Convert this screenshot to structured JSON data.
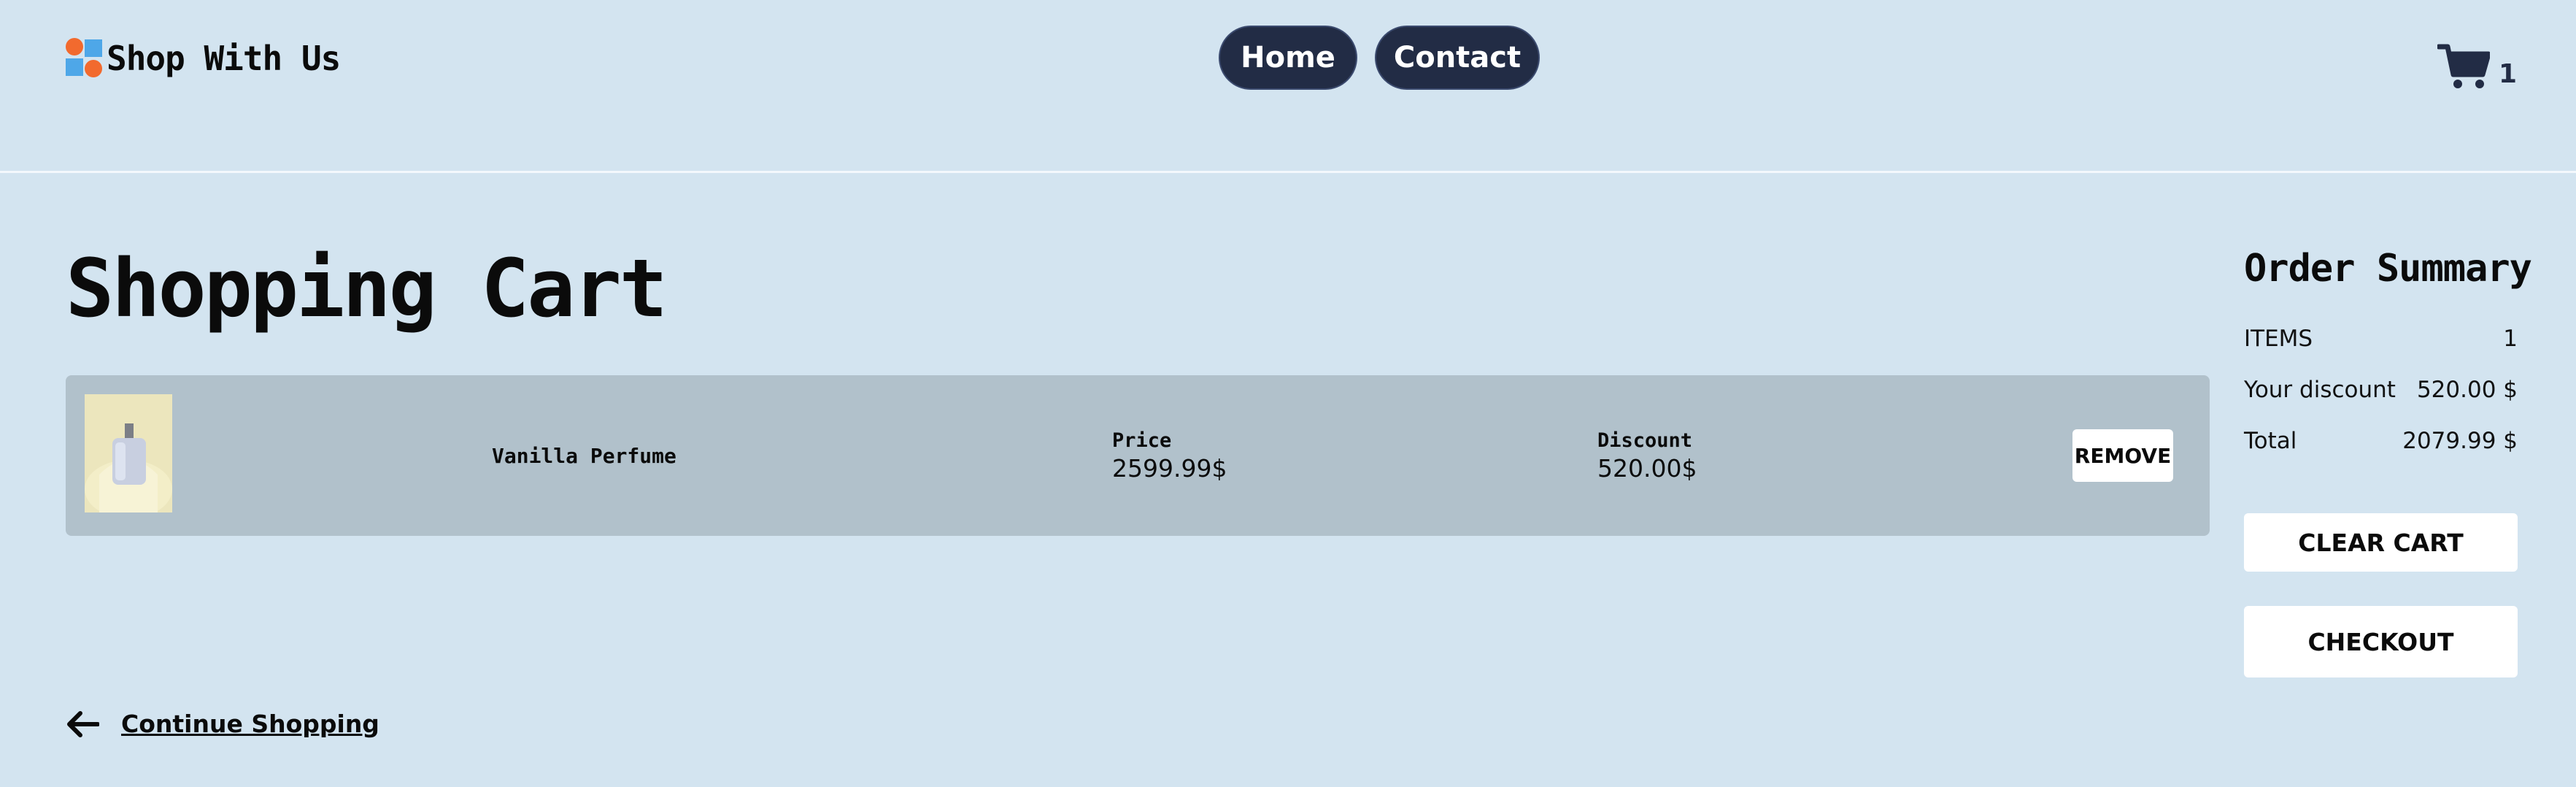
{
  "header": {
    "brand": "Shop With Us",
    "nav": [
      {
        "label": "Home"
      },
      {
        "label": "Contact"
      }
    ],
    "cart_count": "1"
  },
  "main": {
    "title": "Shopping Cart",
    "items": [
      {
        "name": "Vanilla Perfume",
        "price_label": "Price",
        "price": "2599.99$",
        "discount_label": "Discount",
        "discount": "520.00$",
        "remove_label": "REMOVE"
      }
    ],
    "continue_label": "Continue Shopping"
  },
  "summary": {
    "title": "Order Summary",
    "rows": [
      {
        "label": "ITEMS",
        "value": "1"
      },
      {
        "label": "Your discount",
        "value": "520.00 $"
      },
      {
        "label": "Total",
        "value": "2079.99 $"
      }
    ],
    "clear_label": "CLEAR CART",
    "checkout_label": "CHECKOUT"
  },
  "colors": {
    "background": "#d3e4f0",
    "nav_button": "#222c45",
    "cart_row": "#b1c1cb",
    "logo_orange": "#f26a2e",
    "logo_blue": "#4ea7e8"
  },
  "icons": [
    "logo-icon",
    "cart-icon",
    "arrow-left-icon"
  ]
}
